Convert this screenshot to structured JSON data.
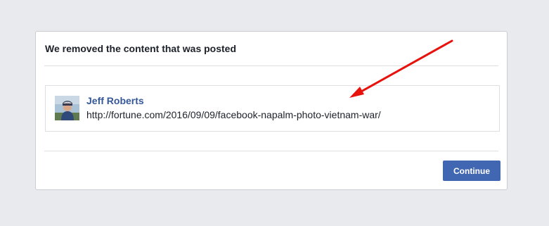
{
  "dialog": {
    "title": "We removed the content that was posted",
    "continue_label": "Continue"
  },
  "post": {
    "author": "Jeff Roberts",
    "url": "http://fortune.com/2016/09/09/facebook-napalm-photo-vietnam-war/",
    "avatar_icon": "profile-photo"
  },
  "annotation": {
    "icon": "red-arrow-icon",
    "color": "#e8120c"
  },
  "colors": {
    "page_background": "#e9eaed",
    "link": "#365899",
    "button": "#4267b2"
  }
}
